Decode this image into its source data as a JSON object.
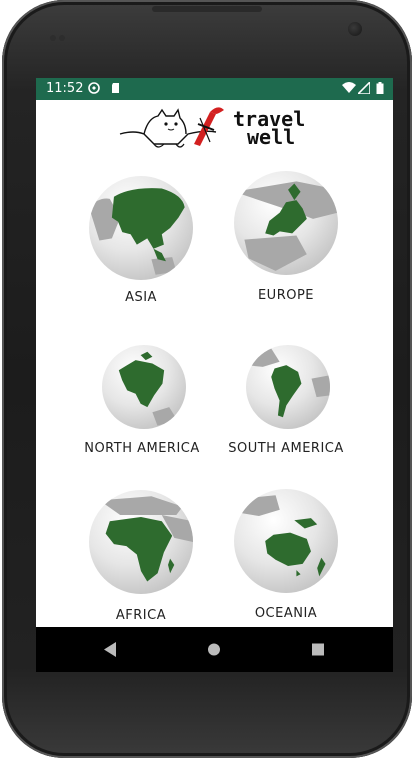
{
  "status_bar": {
    "time": "11:52",
    "icons": [
      "sync-icon",
      "sd-card-icon",
      "wifi-icon",
      "signal-icon",
      "battery-icon"
    ]
  },
  "app": {
    "logo_text_line1": "travel",
    "logo_text_line2": "well"
  },
  "continents": [
    {
      "name": "ASIA"
    },
    {
      "name": "EUROPE"
    },
    {
      "name": "NORTH AMERICA"
    },
    {
      "name": "SOUTH AMERICA"
    },
    {
      "name": "AFRICA"
    },
    {
      "name": "OCEANIA"
    }
  ],
  "nav_bar": {
    "icons": [
      "back-icon",
      "home-icon",
      "recents-icon"
    ]
  },
  "colors": {
    "status_bar": "#1e6a4e",
    "land_highlight": "#2e6b2e",
    "land_other": "#a8a8a8",
    "logo_accent": "#d32020"
  }
}
